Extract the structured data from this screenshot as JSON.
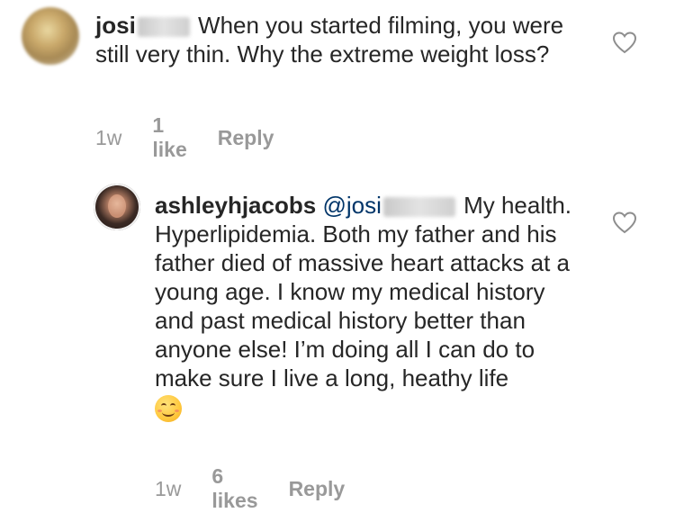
{
  "comments": [
    {
      "username": "josi",
      "text": "When you started filming, you were still very thin. Why the extreme weight loss?",
      "meta": {
        "time": "1w",
        "likes": "1 like",
        "reply": "Reply"
      },
      "icons": {
        "avatar": "user-avatar",
        "like": "heart-icon"
      }
    },
    {
      "username": "ashleyhjacobs",
      "mention": "@josi",
      "text": "My health. Hyperlipidemia. Both my father and his father died of massive heart attacks at a young age. I know my medical history and past medical history better than anyone else! I’m doing all I can do to make sure I live a long, heathy life",
      "emoji": "smiling-face-emoji",
      "meta": {
        "time": "1w",
        "likes": "6 likes",
        "reply": "Reply"
      },
      "icons": {
        "avatar": "user-avatar",
        "like": "heart-icon"
      }
    }
  ]
}
